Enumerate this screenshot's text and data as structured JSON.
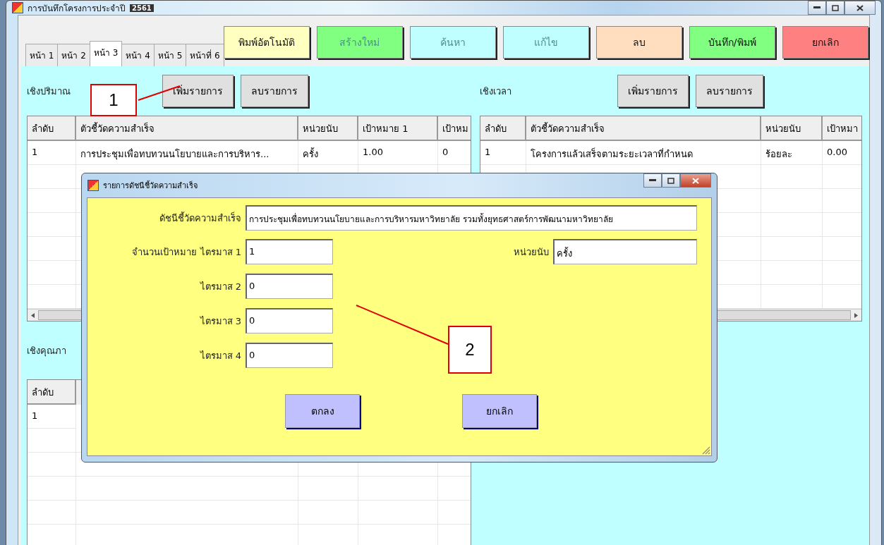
{
  "window": {
    "title": "การบันทึกโครงการประจำปี",
    "year_badge": "2561"
  },
  "tabs": [
    {
      "label": "หน้า 1",
      "selected": false
    },
    {
      "label": "หน้า 2",
      "selected": false
    },
    {
      "label": "หน้า 3",
      "selected": true
    },
    {
      "label": "หน้า 4",
      "selected": false
    },
    {
      "label": "หน้า 5",
      "selected": false
    },
    {
      "label": "หน้าที่ 6",
      "selected": false
    }
  ],
  "toolbar_buttons": [
    {
      "label": "พิมพ์อัตโนมัติ",
      "color": "#ffffc0",
      "disabled": false
    },
    {
      "label": "สร้างใหม่",
      "color": "#80ff80",
      "disabled": true
    },
    {
      "label": "ค้นหา",
      "color": "#c0ffff",
      "disabled": true
    },
    {
      "label": "แก้ไข",
      "color": "#c0ffff",
      "disabled": true
    },
    {
      "label": "ลบ",
      "color": "#ffdec0",
      "disabled": false
    },
    {
      "label": "บันทึก/พิมพ์",
      "color": "#80ff80",
      "disabled": false
    },
    {
      "label": "ยกเลิก",
      "color": "#ff8080",
      "disabled": false
    }
  ],
  "quantitative": {
    "label": "เชิงปริมาณ",
    "buttons": [
      "เพิ่มรายการ",
      "ลบรายการ"
    ],
    "table": {
      "columns": [
        "ลำดับ",
        "ตัวชี้วัดความสำเร็จ",
        "หน่วยนับ",
        "เป้าหมาย 1",
        "เป้าหม"
      ],
      "rows": [
        [
          "1",
          "การประชุมเพื่อทบทวนนโยบายและการบริหาร...",
          "ครั้ง",
          "1.00",
          "0"
        ]
      ]
    }
  },
  "time": {
    "label": "เชิงเวลา",
    "buttons": [
      "เพิ่มรายการ",
      "ลบรายการ"
    ],
    "table": {
      "columns": [
        "ลำดับ",
        "ตัวชี้วัดความสำเร็จ",
        "หน่วยนับ",
        "เป้าหมา"
      ],
      "rows": [
        [
          "1",
          "โครงการแล้วเสร็จตามระยะเวลาที่กำหนด",
          "ร้อยละ",
          "0.00"
        ]
      ]
    }
  },
  "quality": {
    "label": "เชิงคุณภา",
    "table": {
      "columns": [
        "ลำดับ"
      ],
      "rows": [
        [
          "1"
        ]
      ]
    }
  },
  "dialog": {
    "title": "รายการดัชนีชี้วัดความสำเร็จ",
    "indicator": {
      "label": "ดัชนีชี้วัดความสำเร็จ",
      "value": "การประชุมเพื่อทบทวนนโยบายและการบริหารมหาวิทยาลัย รวมทั้งยุทธศาสตร์การพัฒนามหาวิทยาลัย"
    },
    "quarters": [
      {
        "label": "จำนวนเป้าหมาย ไตรมาส 1",
        "value": "1"
      },
      {
        "label": "ไตรมาส 2",
        "value": "0"
      },
      {
        "label": "ไตรมาส 3",
        "value": "0"
      },
      {
        "label": "ไตรมาส 4",
        "value": "0"
      }
    ],
    "unit": {
      "label": "หน่วยนับ",
      "value": "ครั้ง"
    },
    "buttons": [
      "ตกลง",
      "ยกเลิก"
    ]
  },
  "callouts": [
    "1",
    "2"
  ]
}
